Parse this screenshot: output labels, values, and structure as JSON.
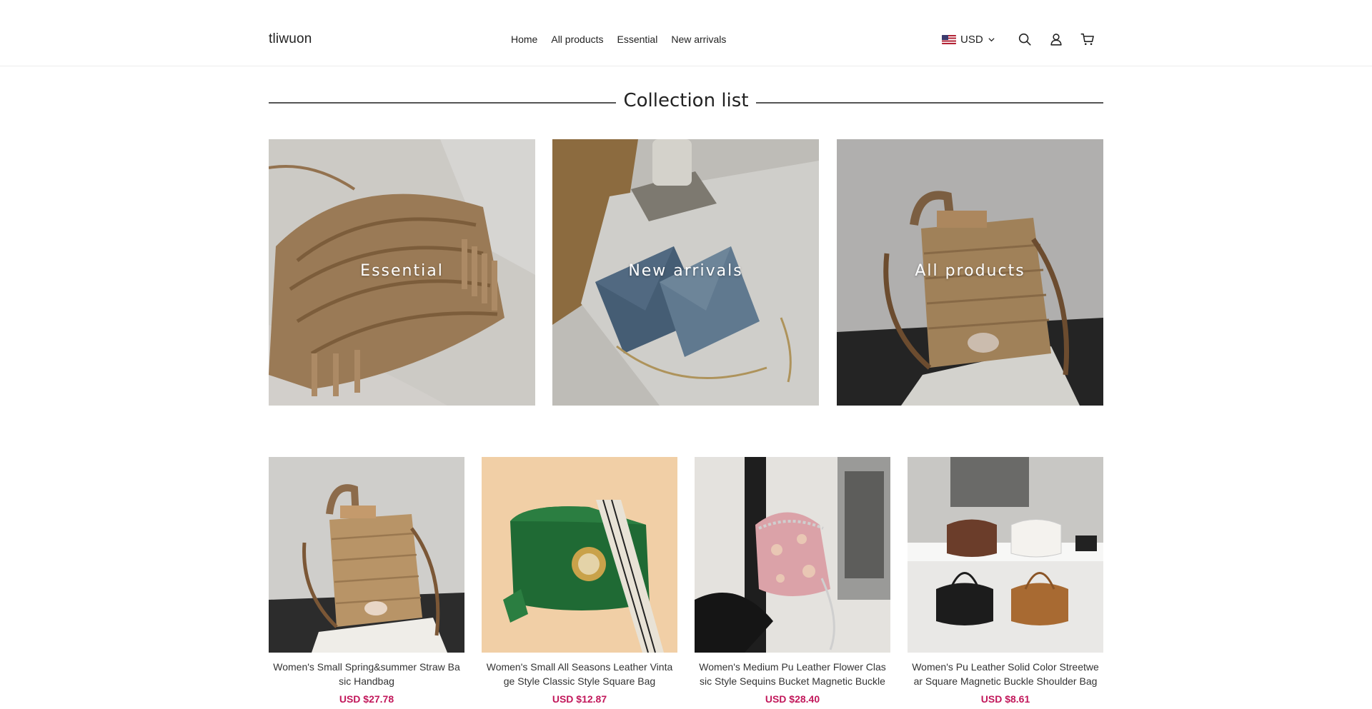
{
  "store": {
    "name": "tliwuon"
  },
  "nav": {
    "items": [
      {
        "label": "Home"
      },
      {
        "label": "All products"
      },
      {
        "label": "Essential"
      },
      {
        "label": "New arrivals"
      }
    ]
  },
  "currency": {
    "code": "USD",
    "flag_icon": "us-flag-icon"
  },
  "header_icons": [
    "search-icon",
    "account-icon",
    "cart-icon"
  ],
  "collection": {
    "title": "Collection list",
    "tiles": [
      {
        "label": "Essential"
      },
      {
        "label": "New arrivals"
      },
      {
        "label": "All products"
      }
    ]
  },
  "products": [
    {
      "title": "Women's Small Spring&summer Straw Basic Handbag",
      "price": "USD $27.78"
    },
    {
      "title": "Women's Small All Seasons Leather Vintage Style Classic Style Square Bag",
      "price": "USD $12.87"
    },
    {
      "title": "Women's Medium Pu Leather Flower Classic Style Sequins Bucket Magnetic Buckle Bag",
      "price": "USD $28.40"
    },
    {
      "title": "Women's Pu Leather Solid Color Streetwear Square Magnetic Buckle Shoulder Bag",
      "price": "USD $8.61"
    }
  ],
  "colors": {
    "price": "#c2185b",
    "text": "#222222",
    "divider": "#ececec"
  }
}
